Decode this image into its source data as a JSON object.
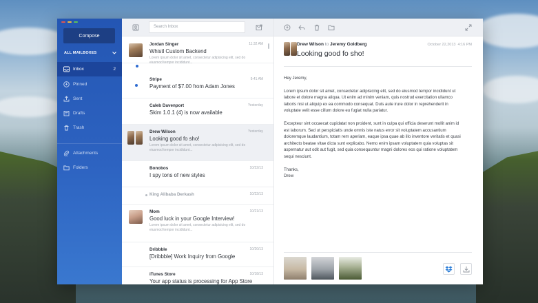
{
  "window_controls": {
    "colors": [
      "#e2564f",
      "#f2bb3d",
      "#5dc25a"
    ]
  },
  "sidebar": {
    "compose_label": "Compose",
    "all_mailboxes_label": "ALL MAILBOXES",
    "items": [
      {
        "label": "Inbox",
        "count": "2",
        "icon": "inbox-icon"
      },
      {
        "label": "Pinned",
        "icon": "pin-icon"
      },
      {
        "label": "Sent",
        "icon": "sent-icon"
      },
      {
        "label": "Drafts",
        "icon": "drafts-icon"
      },
      {
        "label": "Trash",
        "icon": "trash-icon"
      },
      {
        "label": "Attachments",
        "icon": "paperclip-icon"
      },
      {
        "label": "Folders",
        "icon": "folder-icon"
      }
    ]
  },
  "list": {
    "search_placeholder": "Search Inbox",
    "messages": [
      {
        "from": "Jordan Singer",
        "date": "11:32 AM",
        "subject": "Whistl Custom Backend",
        "preview": "Lorem ipsum dolor sit amet, consectetur adipisicing elit, sed do eiusmod tempor incididunt..."
      },
      {
        "from": "Stripe",
        "date": "9:41 AM",
        "subject": "Payment of $7.00 from Adam Jones",
        "preview": ""
      },
      {
        "from": "Caleb Davenport",
        "date": "Yesterday",
        "subject": "Skim 1.0.1 (4) is now available",
        "preview": ""
      },
      {
        "from": "Drew Wilson",
        "date": "Yesterday",
        "subject": "Looking good fo sho!",
        "preview": "Lorem ipsum dolor sit amet, consectetur adipisicing elit, sed do eiusmod tempor incididunt..."
      },
      {
        "from": "Bonobos",
        "date": "10/22/13",
        "subject": "I spy tons of new styles",
        "preview": ""
      },
      {
        "from": "King Alibaba Derkash",
        "date": "10/22/13",
        "subject": "",
        "preview": ""
      },
      {
        "from": "Mom",
        "date": "10/21/13",
        "subject": "Good luck in your Google Interview!",
        "preview": "Lorem ipsum dolor sit amet, consectetur adipisicing elit, sed do eiusmod tempor incididunt..."
      },
      {
        "from": "Dribbble",
        "date": "10/20/13",
        "subject": "[Dribbble] Work Inquiry from Google",
        "preview": ""
      },
      {
        "from": "iTunes Store",
        "date": "10/18/13",
        "subject": "Your app status is processing for App Store",
        "preview": ""
      }
    ]
  },
  "reader": {
    "sender": "Drew Wilson",
    "to_word": "to",
    "recipient": "Jeremy Goldberg",
    "date": "October 22,2013",
    "time": "4:16 PM",
    "subject": "Looking good fo sho!",
    "greeting": "Hey Jeremy,",
    "paragraph1": "Lorem ipsum dolor sit amet, consectetur adipisicing elit, sed do eiusmod tempor incididunt ut labore et dolore magna aliqua. Ut enim ad minim veniam, quis nostrud exercitation ullamco laboris nisi ut aliquip ex ea commodo consequat. Duis aute irure dolor in reprehenderit in voluptate velit esse cillum dolore eu fugiat nulla pariatur.",
    "paragraph2": "Excepteur sint occaecat cupidatat non proident, sunt in culpa qui officia deserunt mollit anim id est laborum. Sed ut perspiciatis unde omnis iste natus error sit voluptatem accusantium doloremque laudantium, totam rem aperiam, eaque ipsa quae ab illo inventore veritatis et quasi architecto beatae vitae dicta sunt explicabo. Nemo enim ipsam voluptatem quia voluptas sit aspernatur aut odit aut fugit, sed quia consequuntur magni dolores eos qui ratione voluptatem sequi nesciunt.",
    "signoff": "Thanks,",
    "signature": "Drew"
  }
}
